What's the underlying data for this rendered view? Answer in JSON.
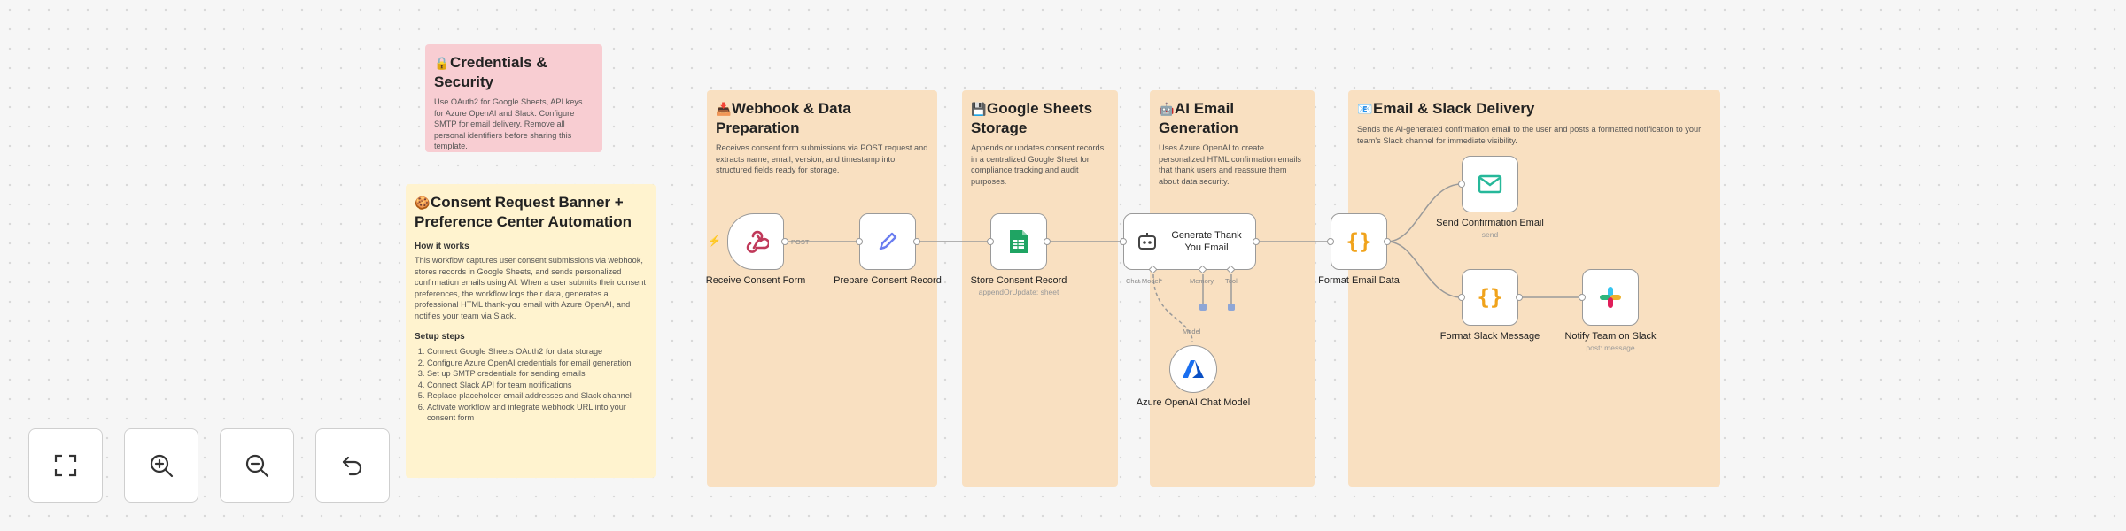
{
  "notes": {
    "credentials": {
      "emoji": "🔒",
      "title": "Credentials & Security",
      "desc": "Use OAuth2 for Google Sheets, API keys for Azure OpenAI and Slack. Configure SMTP for email delivery. Remove all personal identifiers before sharing this template."
    },
    "main": {
      "emoji": "🍪",
      "title": "Consent Request Banner + Preference Center Automation",
      "how_title": "How it works",
      "how_desc": "This workflow captures user consent submissions via webhook, stores records in Google Sheets, and sends personalized confirmation emails using AI. When a user submits their consent preferences, the workflow logs their data, generates a professional HTML thank-you email with Azure OpenAI, and notifies your team via Slack.",
      "setup_title": "Setup steps",
      "steps": [
        "Connect Google Sheets OAuth2 for data storage",
        "Configure Azure OpenAI credentials for email generation",
        "Set up SMTP credentials for sending emails",
        "Connect Slack API for team notifications",
        "Replace placeholder email addresses and Slack channel",
        "Activate workflow and integrate webhook URL into your consent form"
      ]
    },
    "webhook": {
      "emoji": "📥",
      "title": "Webhook & Data Preparation",
      "desc": "Receives consent form submissions via POST request and extracts name, email, version, and timestamp into structured fields ready for storage."
    },
    "sheets": {
      "emoji": "💾",
      "title": "Google Sheets Storage",
      "desc": "Appends or updates consent records in a centralized Google Sheet for compliance tracking and audit purposes."
    },
    "ai": {
      "emoji": "🤖",
      "title": "AI Email Generation",
      "desc": "Uses Azure OpenAI to create personalized HTML confirmation emails that thank users and reassure them about data security."
    },
    "delivery": {
      "emoji": "📧",
      "title": "Email & Slack Delivery",
      "desc": "Sends the AI-generated confirmation email to the user and posts a formatted notification to your team's Slack channel for immediate visibility."
    }
  },
  "nodes": {
    "receive": {
      "label": "Receive Consent Form",
      "edge_label": "POST",
      "icon": "webhook-icon"
    },
    "prepare": {
      "label": "Prepare Consent Record",
      "icon": "pencil-icon"
    },
    "store": {
      "label": "Store Consent Record",
      "sub": "appendOrUpdate: sheet",
      "icon": "google-sheets-icon"
    },
    "generate": {
      "label": "Generate Thank You Email",
      "icon": "ai-agent-icon",
      "port_chat": "Chat Model*",
      "port_memory": "Memory",
      "port_tool": "Tool"
    },
    "azure": {
      "label": "Azure OpenAI Chat Model",
      "edge_label": "Model",
      "icon": "azure-icon"
    },
    "format_email": {
      "label": "Format Email Data",
      "icon": "braces-icon"
    },
    "send_email": {
      "label": "Send Confirmation Email",
      "sub": "send",
      "icon": "email-icon"
    },
    "format_slack": {
      "label": "Format Slack Message",
      "icon": "braces-icon"
    },
    "slack": {
      "label": "Notify Team on Slack",
      "sub": "post: message",
      "icon": "slack-icon"
    }
  },
  "controls": [
    "fit-view",
    "zoom-in",
    "zoom-out",
    "undo"
  ],
  "colors": {
    "note_orange": "#f9e0c1",
    "note_pink": "#f8cdd2",
    "note_yellow": "#fff3cf",
    "wire": "#9a9a9a",
    "trigger_bolt": "#ff5a5f",
    "sheets_green": "#1fa463",
    "email_teal": "#26b89a",
    "braces_orange": "#f0a31c",
    "pencil_blue": "#6a7df0",
    "azure_blue": "#1a6ff0"
  }
}
